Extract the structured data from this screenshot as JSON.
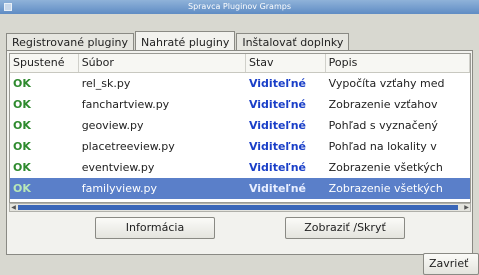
{
  "window": {
    "title": "Spravca Pluginov Gramps"
  },
  "tabs": [
    {
      "label": "Registrované pluginy",
      "active": false
    },
    {
      "label": "Nahraté pluginy",
      "active": true
    },
    {
      "label": "Inštalovať doplnky",
      "active": false
    }
  ],
  "table": {
    "headers": [
      "Spustené",
      "Súbor",
      "Stav",
      "Popis"
    ],
    "rows": [
      {
        "status": "OK",
        "file": "rel_sk.py",
        "state": "Viditeľné",
        "desc": "Vypočíta vzťahy med"
      },
      {
        "status": "OK",
        "file": "fanchartview.py",
        "state": "Viditeľné",
        "desc": "Zobrazenie vzťahov"
      },
      {
        "status": "OK",
        "file": "geoview.py",
        "state": "Viditeľné",
        "desc": "Pohľad s vyznačený"
      },
      {
        "status": "OK",
        "file": "placetreeview.py",
        "state": "Viditeľné",
        "desc": "Pohľad na lokality v"
      },
      {
        "status": "OK",
        "file": "eventview.py",
        "state": "Viditeľné",
        "desc": "Zobrazenie všetkých"
      },
      {
        "status": "OK",
        "file": "familyview.py",
        "state": "Viditeľné",
        "desc": "Zobrazenie všetkých",
        "selected": true
      }
    ]
  },
  "buttons": {
    "info": "Informácia",
    "toggle": "Zobraziť /Skryť",
    "close": "Zavrieť"
  },
  "colors": {
    "selection": "#5a7fc9",
    "ok": "#2e8a2e",
    "visible": "#1a3fc8"
  }
}
